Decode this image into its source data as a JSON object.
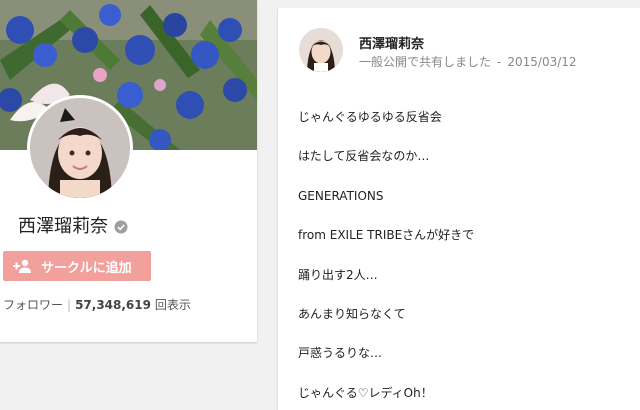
{
  "profile": {
    "name": "西澤瑠莉奈",
    "add_button_label": "サークルに追加",
    "followers_label": "フォロワー",
    "followers_count": "57,348,619",
    "views_label": "回表示"
  },
  "post": {
    "author": "西澤瑠莉奈",
    "visibility": "一般公開で共有しました",
    "separator": "-",
    "date": "2015/03/12",
    "lines": [
      "じゃんぐるゆるゆる反省会",
      "はたして反省会なのか…",
      "GENERATIONS",
      "from EXILE TRIBEさんが好きで",
      "踊り出す2人…",
      "あんまり知らなくて",
      "戸惑うるりな…",
      "じゃんぐる♡レディOh！"
    ]
  },
  "colors": {
    "add_button": "#f1a09b",
    "page_background": "#f1f1f1"
  },
  "icons": {
    "verified": "verified-badge-icon",
    "add_person": "person-add-icon"
  }
}
